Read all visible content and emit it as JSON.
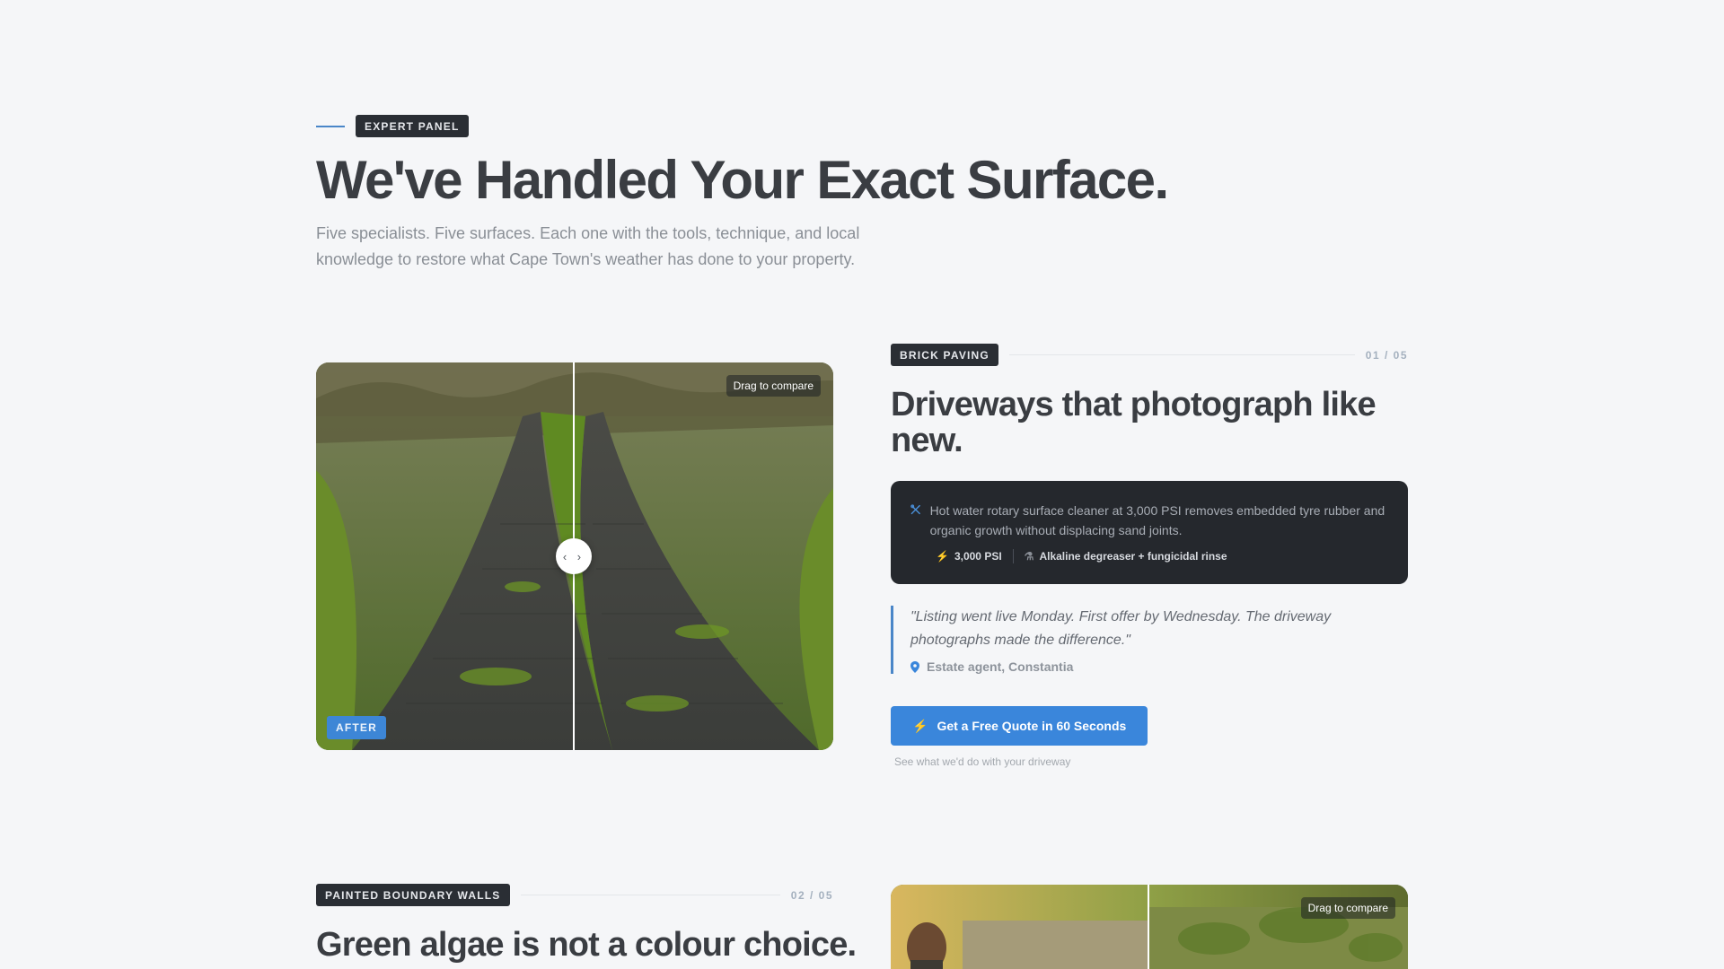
{
  "header": {
    "eyebrow": "EXPERT PANEL",
    "title": "We've Handled Your Exact Surface.",
    "subtitle": "Five specialists. Five surfaces. Each one with the tools, technique, and local knowledge to restore what Cape Town's weather has done to your property."
  },
  "sections": [
    {
      "tag": "BRICK PAVING",
      "count": "01 / 05",
      "title": "Driveways that photograph like new.",
      "compare": {
        "hint": "Drag to compare",
        "after_label": "AFTER",
        "handle_glyph": "‹ ›",
        "split_percent": 50
      },
      "spec": {
        "icon": "tools-icon",
        "text": "Hot water rotary surface cleaner at 3,000 PSI removes embedded tyre rubber and organic growth without displacing sand joints.",
        "pills": [
          {
            "icon": "bolt-icon",
            "label": "3,000 PSI"
          },
          {
            "icon": "flask-icon",
            "label": "Alkaline degreaser + fungicidal rinse"
          }
        ]
      },
      "quote": {
        "text": "\"Listing went live Monday. First offer by Wednesday. The driveway photographs made the difference.\"",
        "author": "Estate agent, Constantia"
      },
      "cta": {
        "label": "Get a Free Quote in 60 Seconds",
        "note": "See what we'd do with your driveway"
      }
    },
    {
      "tag": "PAINTED BOUNDARY WALLS",
      "count": "02 / 05",
      "title": "Green algae is not a colour choice.",
      "compare": {
        "hint": "Drag to compare"
      }
    }
  ],
  "colors": {
    "accent": "#3a86db",
    "dark_card": "#25282d",
    "background": "#f5f6f8"
  }
}
